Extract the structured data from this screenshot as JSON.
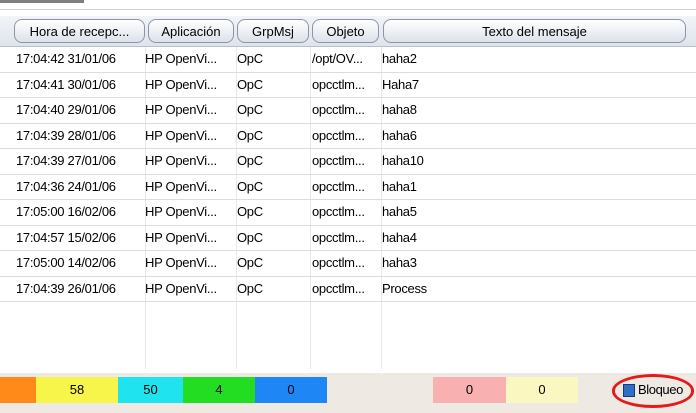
{
  "columns": {
    "hora": "Hora de recepc...",
    "aplicacion": "Aplicación",
    "grpmsj": "GrpMsj",
    "objeto": "Objeto",
    "texto": "Texto del mensaje"
  },
  "rows": [
    {
      "hora": "17:04:42 31/01/06",
      "app": "HP OpenVi...",
      "grp": "OpC",
      "obj": "/opt/OV...",
      "txt": "haha2"
    },
    {
      "hora": "17:04:41 30/01/06",
      "app": "HP OpenVi...",
      "grp": "OpC",
      "obj": "opcctlm...",
      "txt": "Haha7"
    },
    {
      "hora": "17:04:40 29/01/06",
      "app": "HP OpenVi...",
      "grp": "OpC",
      "obj": "opcctlm...",
      "txt": "haha8"
    },
    {
      "hora": "17:04:39 28/01/06",
      "app": "HP OpenVi...",
      "grp": "OpC",
      "obj": "opcctlm...",
      "txt": "haha6"
    },
    {
      "hora": "17:04:39 27/01/06",
      "app": "HP OpenVi...",
      "grp": "OpC",
      "obj": "opcctlm...",
      "txt": "haha10"
    },
    {
      "hora": "17:04:36 24/01/06",
      "app": "HP OpenVi...",
      "grp": "OpC",
      "obj": "opcctlm...",
      "txt": "haha1"
    },
    {
      "hora": "17:05:00 16/02/06",
      "app": "HP OpenVi...",
      "grp": "OpC",
      "obj": "opcctlm...",
      "txt": "haha5"
    },
    {
      "hora": "17:04:57 15/02/06",
      "app": "HP OpenVi...",
      "grp": "OpC",
      "obj": "opcctlm...",
      "txt": "haha4"
    },
    {
      "hora": "17:05:00 14/02/06",
      "app": "HP OpenVi...",
      "grp": "OpC",
      "obj": "opcctlm...",
      "txt": "haha3"
    },
    {
      "hora": "17:04:39 26/01/06",
      "app": "HP OpenVi...",
      "grp": "OpC",
      "obj": "opcctlm...",
      "txt": "Process"
    }
  ],
  "status": {
    "segments": [
      {
        "value": "",
        "color": "#ff8a1a"
      },
      {
        "value": "58",
        "color": "#f7f44a"
      },
      {
        "value": "50",
        "color": "#1fe4f0"
      },
      {
        "value": "4",
        "color": "#22dd22"
      },
      {
        "value": "0",
        "color": "#1f86f5"
      },
      {
        "value": "0",
        "color": "#f9b0b0"
      },
      {
        "value": "0",
        "color": "#fbf7c0"
      }
    ],
    "lock_label": "Bloqueo",
    "lock_icon": "lock-document-icon",
    "highlight_color": "#e31b1b"
  }
}
